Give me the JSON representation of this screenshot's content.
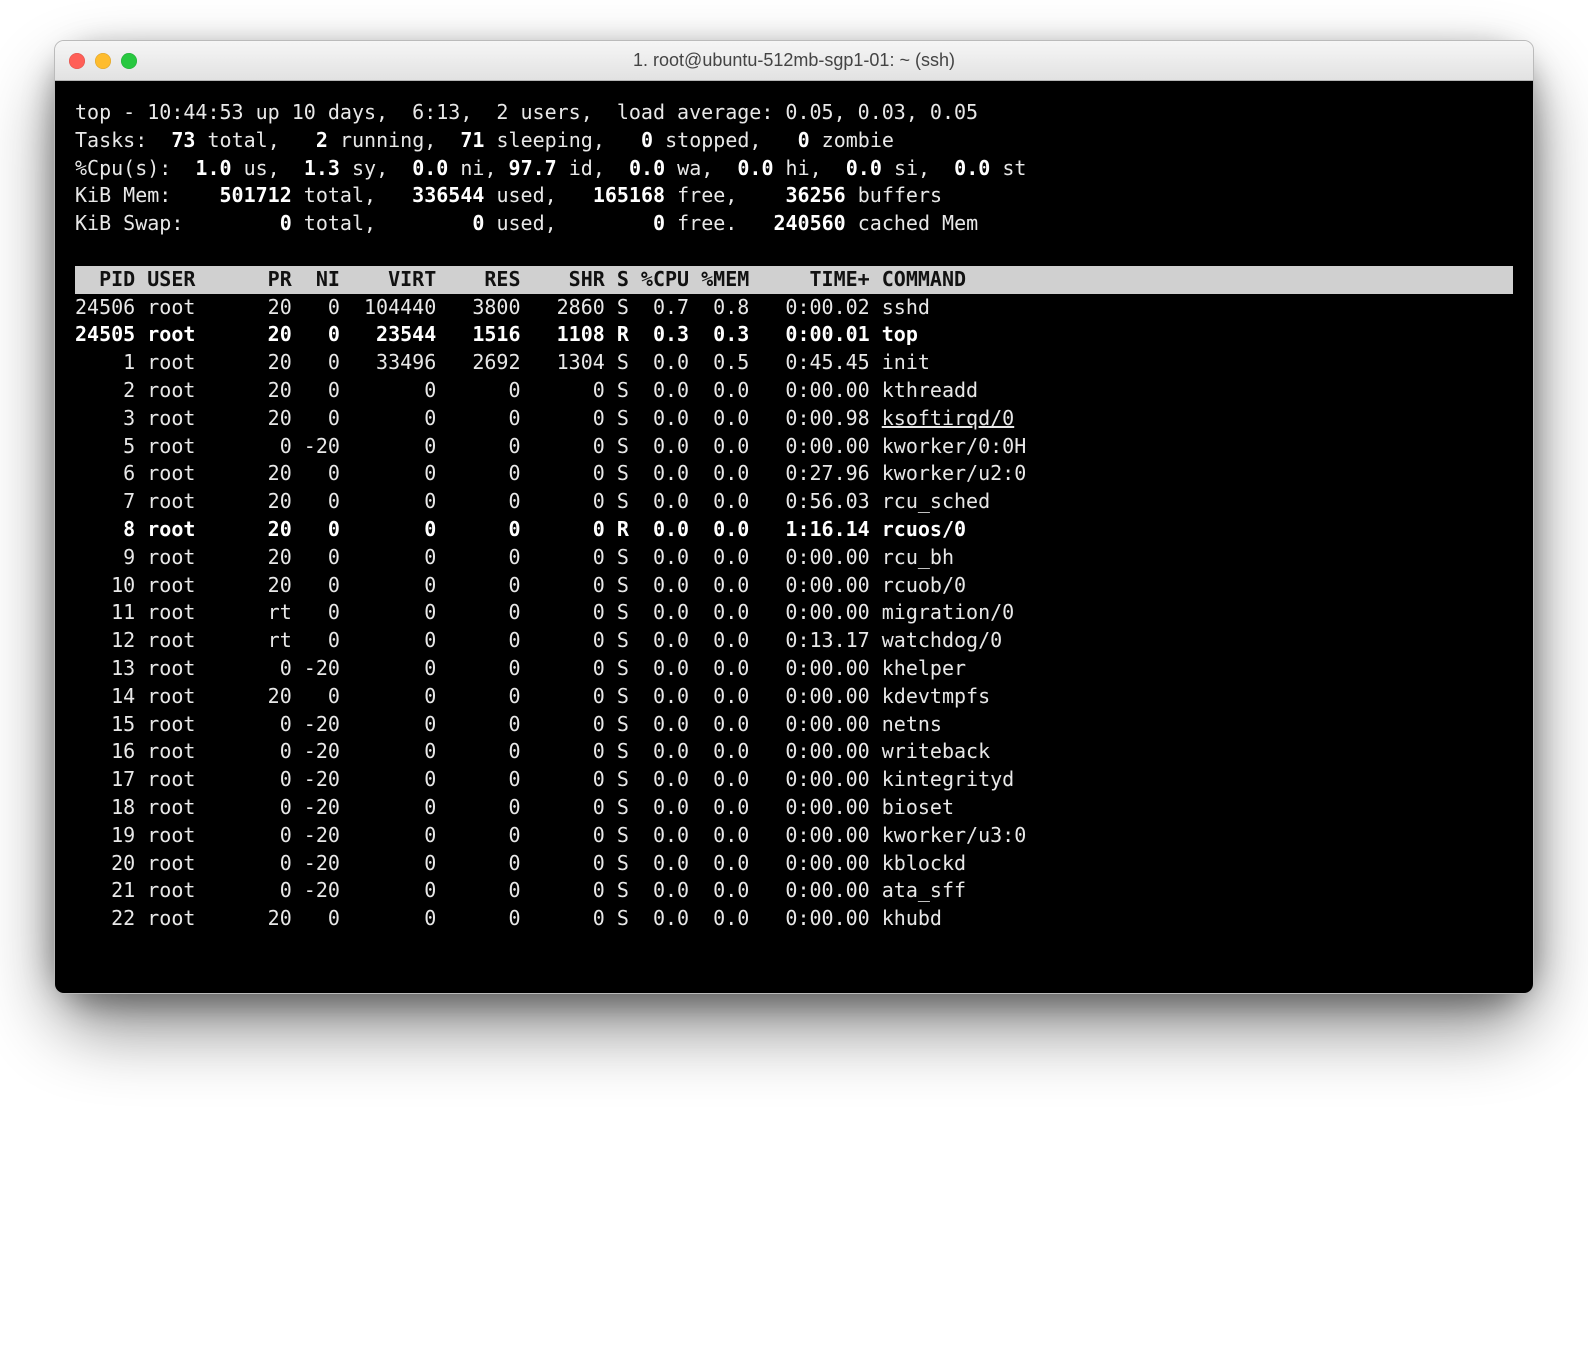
{
  "window": {
    "title": "1. root@ubuntu-512mb-sgp1-01: ~ (ssh)"
  },
  "summary": {
    "line1_a": "top - 10:44:53 up 10 days,  6:13,  2 users,  load average: 0.05, 0.03, 0.05",
    "tasks": {
      "label": "Tasks:",
      "total": "73",
      "total_l": "total,",
      "running": "2",
      "running_l": "running,",
      "sleeping": "71",
      "sleeping_l": "sleeping,",
      "stopped": "0",
      "stopped_l": "stopped,",
      "zombie": "0",
      "zombie_l": "zombie"
    },
    "cpu": {
      "label": "%Cpu(s):",
      "us": "1.0",
      "us_l": "us,",
      "sy": "1.3",
      "sy_l": "sy,",
      "ni": "0.0",
      "ni_l": "ni,",
      "id": "97.7",
      "id_l": "id,",
      "wa": "0.0",
      "wa_l": "wa,",
      "hi": "0.0",
      "hi_l": "hi,",
      "si": "0.0",
      "si_l": "si,",
      "st": "0.0",
      "st_l": "st"
    },
    "mem": {
      "label": "KiB Mem:",
      "total": "501712",
      "total_l": "total,",
      "used": "336544",
      "used_l": "used,",
      "free": "165168",
      "free_l": "free,",
      "buf": "36256",
      "buf_l": "buffers"
    },
    "swap": {
      "label": "KiB Swap:",
      "total": "0",
      "total_l": "total,",
      "used": "0",
      "used_l": "used,",
      "free": "0",
      "free_l": "free.",
      "cache": "240560",
      "cache_l": "cached Mem"
    }
  },
  "columns": {
    "pid": "PID",
    "user": "USER",
    "pr": "PR",
    "ni": "NI",
    "virt": "VIRT",
    "res": "RES",
    "shr": "SHR",
    "s": "S",
    "cpu": "%CPU",
    "mem": "%MEM",
    "time": "TIME+",
    "cmd": "COMMAND"
  },
  "processes": [
    {
      "pid": "24506",
      "user": "root",
      "pr": "20",
      "ni": "0",
      "virt": "104440",
      "res": "3800",
      "shr": "2860",
      "s": "S",
      "cpu": "0.7",
      "mem": "0.8",
      "time": "0:00.02",
      "cmd": "sshd",
      "bold": false
    },
    {
      "pid": "24505",
      "user": "root",
      "pr": "20",
      "ni": "0",
      "virt": "23544",
      "res": "1516",
      "shr": "1108",
      "s": "R",
      "cpu": "0.3",
      "mem": "0.3",
      "time": "0:00.01",
      "cmd": "top",
      "bold": true
    },
    {
      "pid": "1",
      "user": "root",
      "pr": "20",
      "ni": "0",
      "virt": "33496",
      "res": "2692",
      "shr": "1304",
      "s": "S",
      "cpu": "0.0",
      "mem": "0.5",
      "time": "0:45.45",
      "cmd": "init",
      "bold": false
    },
    {
      "pid": "2",
      "user": "root",
      "pr": "20",
      "ni": "0",
      "virt": "0",
      "res": "0",
      "shr": "0",
      "s": "S",
      "cpu": "0.0",
      "mem": "0.0",
      "time": "0:00.00",
      "cmd": "kthreadd",
      "bold": false
    },
    {
      "pid": "3",
      "user": "root",
      "pr": "20",
      "ni": "0",
      "virt": "0",
      "res": "0",
      "shr": "0",
      "s": "S",
      "cpu": "0.0",
      "mem": "0.0",
      "time": "0:00.98",
      "cmd": "ksoftirqd/0",
      "bold": false,
      "underline": true
    },
    {
      "pid": "5",
      "user": "root",
      "pr": "0",
      "ni": "-20",
      "virt": "0",
      "res": "0",
      "shr": "0",
      "s": "S",
      "cpu": "0.0",
      "mem": "0.0",
      "time": "0:00.00",
      "cmd": "kworker/0:0H",
      "bold": false
    },
    {
      "pid": "6",
      "user": "root",
      "pr": "20",
      "ni": "0",
      "virt": "0",
      "res": "0",
      "shr": "0",
      "s": "S",
      "cpu": "0.0",
      "mem": "0.0",
      "time": "0:27.96",
      "cmd": "kworker/u2:0",
      "bold": false
    },
    {
      "pid": "7",
      "user": "root",
      "pr": "20",
      "ni": "0",
      "virt": "0",
      "res": "0",
      "shr": "0",
      "s": "S",
      "cpu": "0.0",
      "mem": "0.0",
      "time": "0:56.03",
      "cmd": "rcu_sched",
      "bold": false
    },
    {
      "pid": "8",
      "user": "root",
      "pr": "20",
      "ni": "0",
      "virt": "0",
      "res": "0",
      "shr": "0",
      "s": "R",
      "cpu": "0.0",
      "mem": "0.0",
      "time": "1:16.14",
      "cmd": "rcuos/0",
      "bold": true
    },
    {
      "pid": "9",
      "user": "root",
      "pr": "20",
      "ni": "0",
      "virt": "0",
      "res": "0",
      "shr": "0",
      "s": "S",
      "cpu": "0.0",
      "mem": "0.0",
      "time": "0:00.00",
      "cmd": "rcu_bh",
      "bold": false
    },
    {
      "pid": "10",
      "user": "root",
      "pr": "20",
      "ni": "0",
      "virt": "0",
      "res": "0",
      "shr": "0",
      "s": "S",
      "cpu": "0.0",
      "mem": "0.0",
      "time": "0:00.00",
      "cmd": "rcuob/0",
      "bold": false
    },
    {
      "pid": "11",
      "user": "root",
      "pr": "rt",
      "ni": "0",
      "virt": "0",
      "res": "0",
      "shr": "0",
      "s": "S",
      "cpu": "0.0",
      "mem": "0.0",
      "time": "0:00.00",
      "cmd": "migration/0",
      "bold": false
    },
    {
      "pid": "12",
      "user": "root",
      "pr": "rt",
      "ni": "0",
      "virt": "0",
      "res": "0",
      "shr": "0",
      "s": "S",
      "cpu": "0.0",
      "mem": "0.0",
      "time": "0:13.17",
      "cmd": "watchdog/0",
      "bold": false
    },
    {
      "pid": "13",
      "user": "root",
      "pr": "0",
      "ni": "-20",
      "virt": "0",
      "res": "0",
      "shr": "0",
      "s": "S",
      "cpu": "0.0",
      "mem": "0.0",
      "time": "0:00.00",
      "cmd": "khelper",
      "bold": false
    },
    {
      "pid": "14",
      "user": "root",
      "pr": "20",
      "ni": "0",
      "virt": "0",
      "res": "0",
      "shr": "0",
      "s": "S",
      "cpu": "0.0",
      "mem": "0.0",
      "time": "0:00.00",
      "cmd": "kdevtmpfs",
      "bold": false
    },
    {
      "pid": "15",
      "user": "root",
      "pr": "0",
      "ni": "-20",
      "virt": "0",
      "res": "0",
      "shr": "0",
      "s": "S",
      "cpu": "0.0",
      "mem": "0.0",
      "time": "0:00.00",
      "cmd": "netns",
      "bold": false
    },
    {
      "pid": "16",
      "user": "root",
      "pr": "0",
      "ni": "-20",
      "virt": "0",
      "res": "0",
      "shr": "0",
      "s": "S",
      "cpu": "0.0",
      "mem": "0.0",
      "time": "0:00.00",
      "cmd": "writeback",
      "bold": false
    },
    {
      "pid": "17",
      "user": "root",
      "pr": "0",
      "ni": "-20",
      "virt": "0",
      "res": "0",
      "shr": "0",
      "s": "S",
      "cpu": "0.0",
      "mem": "0.0",
      "time": "0:00.00",
      "cmd": "kintegrityd",
      "bold": false
    },
    {
      "pid": "18",
      "user": "root",
      "pr": "0",
      "ni": "-20",
      "virt": "0",
      "res": "0",
      "shr": "0",
      "s": "S",
      "cpu": "0.0",
      "mem": "0.0",
      "time": "0:00.00",
      "cmd": "bioset",
      "bold": false
    },
    {
      "pid": "19",
      "user": "root",
      "pr": "0",
      "ni": "-20",
      "virt": "0",
      "res": "0",
      "shr": "0",
      "s": "S",
      "cpu": "0.0",
      "mem": "0.0",
      "time": "0:00.00",
      "cmd": "kworker/u3:0",
      "bold": false
    },
    {
      "pid": "20",
      "user": "root",
      "pr": "0",
      "ni": "-20",
      "virt": "0",
      "res": "0",
      "shr": "0",
      "s": "S",
      "cpu": "0.0",
      "mem": "0.0",
      "time": "0:00.00",
      "cmd": "kblockd",
      "bold": false
    },
    {
      "pid": "21",
      "user": "root",
      "pr": "0",
      "ni": "-20",
      "virt": "0",
      "res": "0",
      "shr": "0",
      "s": "S",
      "cpu": "0.0",
      "mem": "0.0",
      "time": "0:00.00",
      "cmd": "ata_sff",
      "bold": false
    },
    {
      "pid": "22",
      "user": "root",
      "pr": "20",
      "ni": "0",
      "virt": "0",
      "res": "0",
      "shr": "0",
      "s": "S",
      "cpu": "0.0",
      "mem": "0.0",
      "time": "0:00.00",
      "cmd": "khubd",
      "bold": false
    }
  ]
}
